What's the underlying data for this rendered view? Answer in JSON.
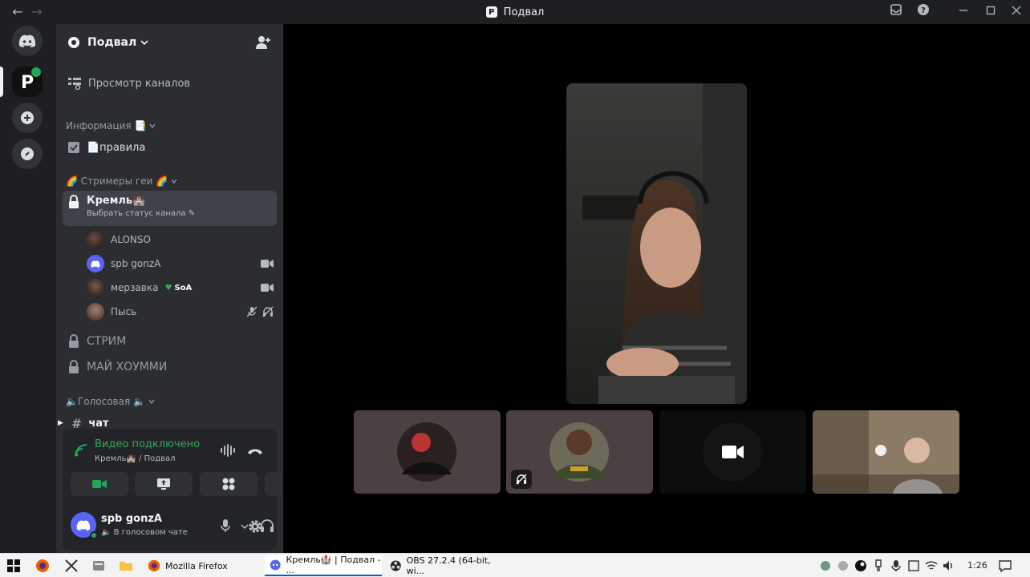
{
  "window": {
    "title": "Подвал",
    "back": "←",
    "forward": "→",
    "server_letter": "P"
  },
  "sidebar": {
    "server_name": "Подвал",
    "browse_channels": "Просмотр каналов",
    "categories": [
      {
        "label": "Информация 📑"
      },
      {
        "label": "🌈 Стримеры геи 🌈"
      },
      {
        "label": "🔈Голосовая 🔈"
      }
    ],
    "channels": {
      "rules": "📄правила",
      "kremlin_title": "Кремль🏰",
      "kremlin_sub": "Выбрать статус канала",
      "stream": "СТРИМ",
      "my_home": "МАЙ ХОУММИ",
      "chat": "чат"
    },
    "members": [
      {
        "name": "ALONSO"
      },
      {
        "name": "spb gonzA"
      },
      {
        "name": "мерзавка",
        "badge": "SoA"
      },
      {
        "name": "Пысь"
      }
    ]
  },
  "voice": {
    "status": "Видео подключено",
    "location": "Кремль🏰 / Подвал"
  },
  "user": {
    "name": "spb gonzA",
    "status": "В голосовом чате"
  },
  "taskbar": {
    "apps": [
      {
        "label": "Mozilla Firefox"
      },
      {
        "label": "Кремль🏰 | Подвал - ..."
      },
      {
        "label": "OBS 27.2.4 (64-bit, wi..."
      }
    ],
    "clock": "1:26"
  },
  "colors": {
    "green": "#23a55a",
    "blurple": "#5865f2",
    "sidebar": "#2b2d31",
    "rail": "#1e1f22"
  }
}
